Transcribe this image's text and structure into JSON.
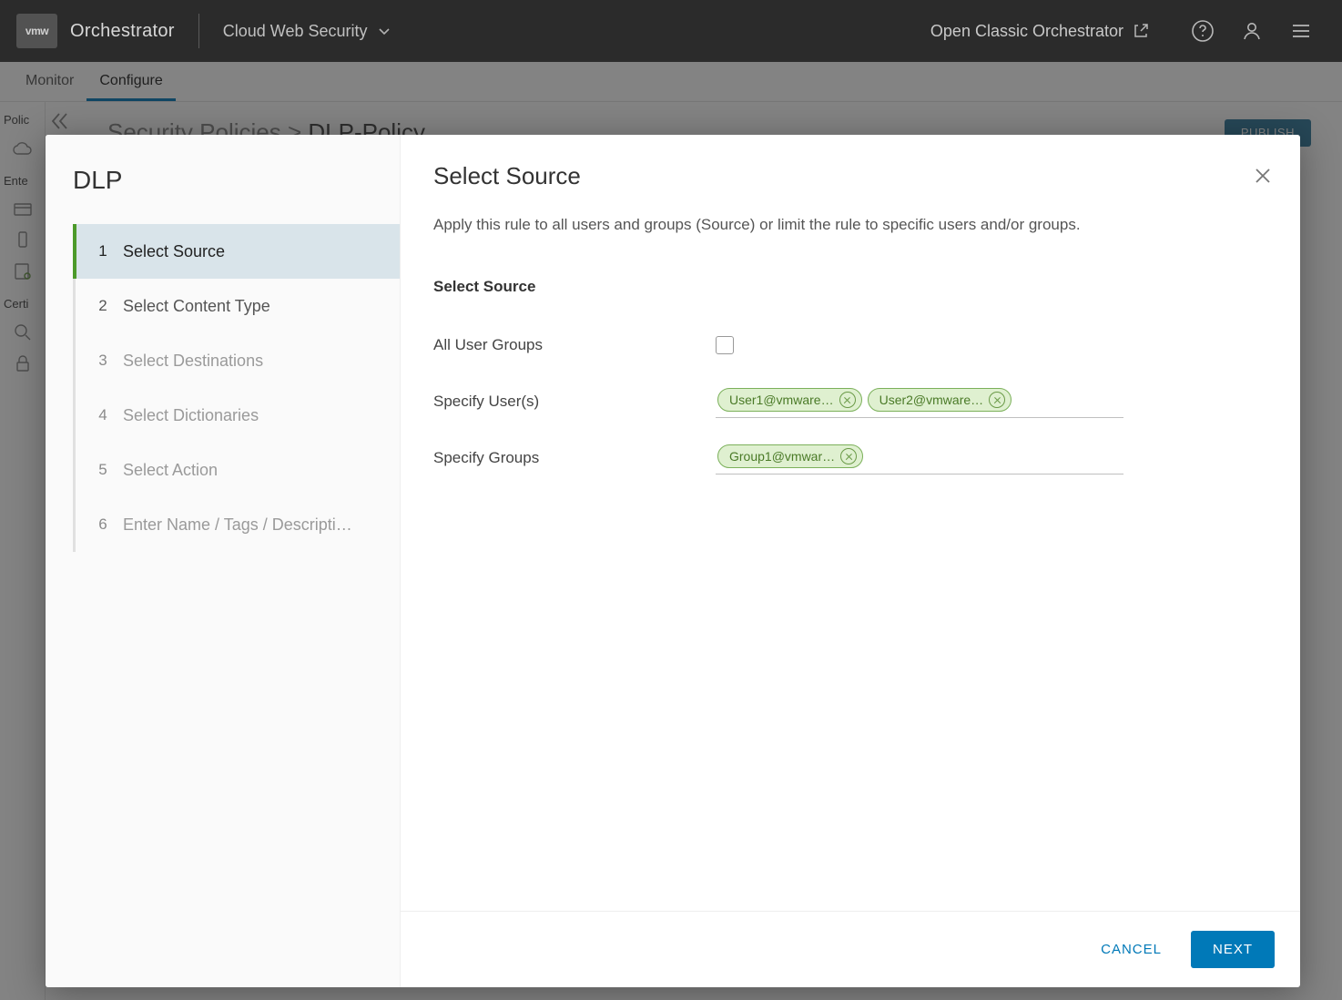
{
  "header": {
    "logo_text": "vmw",
    "brand": "Orchestrator",
    "product": "Cloud Web Security",
    "classic_link": "Open Classic Orchestrator"
  },
  "tabs": {
    "monitor": "Monitor",
    "configure": "Configure"
  },
  "sidebar": {
    "policies_label": "Polic",
    "enterprise_label": "Ente",
    "cert_label": "Certi"
  },
  "breadcrumb": {
    "parent": "Security Policies",
    "sep": ">",
    "current": "DLP-Policy"
  },
  "publish_btn": "PUBLISH",
  "modal": {
    "wizard_title": "DLP",
    "steps": [
      "Select Source",
      "Select Content Type",
      "Select Destinations",
      "Select Dictionaries",
      "Select Action",
      "Enter Name / Tags / Descripti…"
    ],
    "active_step": 0,
    "panel_title": "Select Source",
    "panel_desc": "Apply this rule to all users and groups (Source) or limit the rule to specific users and/or groups.",
    "section_heading": "Select Source",
    "rows": {
      "all_groups_label": "All User Groups",
      "specify_users_label": "Specify User(s)",
      "specify_groups_label": "Specify Groups"
    },
    "user_chips": [
      "User1@vmware…",
      "User2@vmware…"
    ],
    "group_chips": [
      "Group1@vmwar…"
    ],
    "footer": {
      "cancel": "CANCEL",
      "next": "NEXT"
    }
  }
}
